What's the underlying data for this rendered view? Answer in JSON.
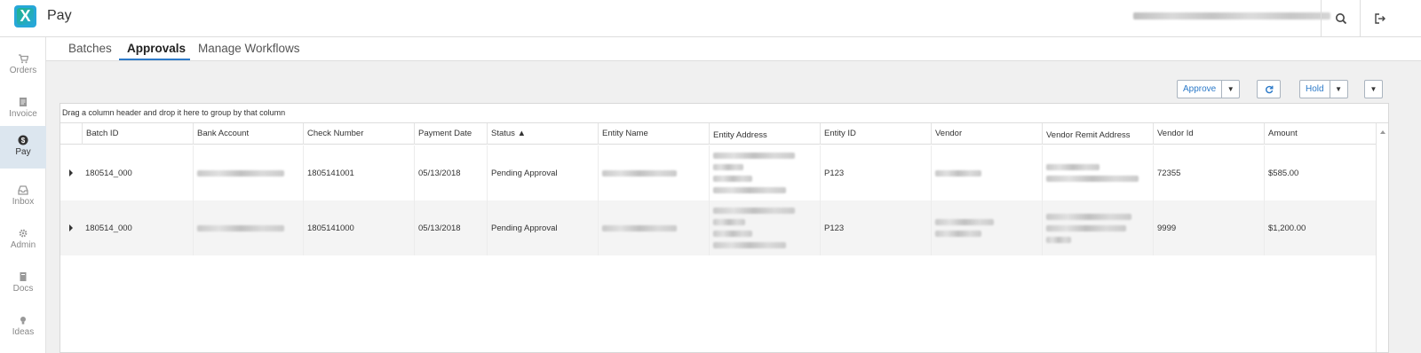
{
  "app": {
    "title": "Pay",
    "logo_letter": "X"
  },
  "topbar": {
    "search_icon": "search-icon",
    "logout_icon": "logout-icon"
  },
  "sidebar": {
    "items": [
      {
        "label": "Orders",
        "icon": "cart-icon"
      },
      {
        "label": "Invoice",
        "icon": "invoice-icon"
      },
      {
        "label": "Pay",
        "icon": "dollar-circle-icon",
        "active": true
      },
      {
        "label": "Inbox",
        "icon": "inbox-icon"
      },
      {
        "label": "Admin",
        "icon": "gear-icon"
      },
      {
        "label": "Docs",
        "icon": "document-icon"
      },
      {
        "label": "Ideas",
        "icon": "lightbulb-icon"
      }
    ]
  },
  "tabs": [
    "Batches",
    "Approvals",
    "Manage Workflows"
  ],
  "active_tab": "Approvals",
  "toolbar": {
    "approve_label": "Approve",
    "refresh_icon": "refresh-icon",
    "hold_label": "Hold",
    "caret": "▼"
  },
  "grid": {
    "group_hint": "Drag a column header and drop it here to group by that column",
    "columns": [
      "Batch ID",
      "Bank Account",
      "Check Number",
      "Payment Date",
      "Status ▲",
      "Entity Name",
      "Entity Address",
      "Entity ID",
      "Vendor",
      "Vendor Remit Address",
      "Vendor Id",
      "Amount"
    ],
    "rows": [
      {
        "batch_id": "180514_000",
        "check_number": "1805141001",
        "payment_date": "05/13/2018",
        "status": "Pending Approval",
        "entity_id": "P123",
        "vendor_id": "72355",
        "amount": "$585.00"
      },
      {
        "batch_id": "180514_000",
        "check_number": "1805141000",
        "payment_date": "05/13/2018",
        "status": "Pending Approval",
        "entity_id": "P123",
        "vendor_id": "9999",
        "amount": "$1,200.00"
      }
    ]
  },
  "colors": {
    "accent": "#2c7ac9",
    "active_sidebar": "#dce6ef",
    "content_bg": "#f0f0f0"
  }
}
